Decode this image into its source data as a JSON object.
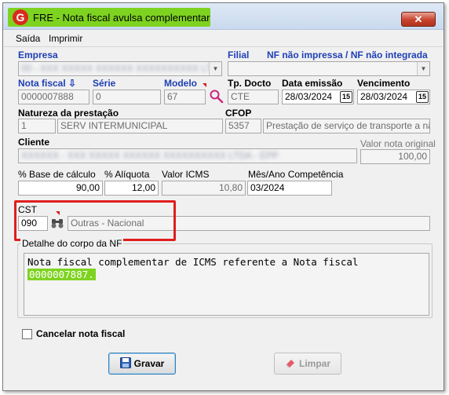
{
  "window": {
    "title": "FRE - Nota fiscal avulsa complementar",
    "close_glyph": "✕",
    "app_icon_letter": "G"
  },
  "menu": {
    "items": [
      {
        "label": "Saída"
      },
      {
        "label": "Imprimir"
      }
    ]
  },
  "empresa": {
    "label": "Empresa",
    "value": "00 - XXX XXXXX XXXXXX XXXXXXXXXX LTDA"
  },
  "filial": {
    "label": "Filial",
    "value": ""
  },
  "nf_status": {
    "label": "NF não impressa / NF não integrada"
  },
  "nota_fiscal": {
    "label": "Nota fiscal ⇩",
    "value": "0000007888"
  },
  "serie": {
    "label": "Série",
    "value": "0"
  },
  "modelo": {
    "label": "Modelo",
    "value": "67"
  },
  "tp_docto": {
    "label": "Tp. Docto",
    "value": "CTE"
  },
  "data_emissao": {
    "label": "Data emissão",
    "value": "28/03/2024",
    "button": "15"
  },
  "vencimento": {
    "label": "Vencimento",
    "value": "28/03/2024",
    "button": "15"
  },
  "natureza": {
    "label": "Natureza da prestação",
    "code": "1",
    "description": "SERV INTERMUNICIPAL"
  },
  "cfop": {
    "label": "CFOP",
    "code": "5357",
    "description": "Prestação de serviço de transporte a não co"
  },
  "cliente": {
    "label": "Cliente",
    "value": "XXXXXX - XXX XXXXX XXXXXX XXXXXXXXXX LTDA - EPP"
  },
  "valor_nota_original": {
    "label": "Valor nota original",
    "value": "100,00"
  },
  "base_calculo": {
    "label": "% Base de cálculo",
    "value": "90,00"
  },
  "aliquota": {
    "label": "% Alíquota",
    "value": "12,00"
  },
  "valor_icms": {
    "label": "Valor ICMS",
    "value": "10,80"
  },
  "competencia": {
    "label": "Mês/Ano Competência",
    "value": "03/2024"
  },
  "cst": {
    "label": "CST",
    "code": "090",
    "description": "Outras - Nacional"
  },
  "detalhe": {
    "legend": "Detalhe do corpo da NF",
    "line1": "Nota fiscal complementar de ICMS referente a Nota fiscal",
    "line2_highlight": "0000007887."
  },
  "cancelar": {
    "label": "Cancelar nota fiscal",
    "checked": false
  },
  "buttons": {
    "gravar": "Gravar",
    "limpar": "Limpar"
  },
  "colors": {
    "highlight_green": "#7ed321",
    "label_blue": "#1f3fb5",
    "callout_red": "#e01e1e"
  }
}
